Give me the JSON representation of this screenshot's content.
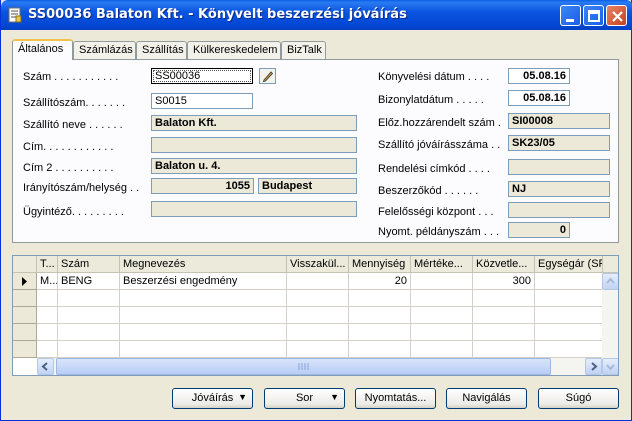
{
  "window": {
    "title": "SS00036 Balaton Kft. - Könyvelt beszerzési jóváírás"
  },
  "tabs": [
    {
      "label": "Általános",
      "active": true
    },
    {
      "label": "Számlázás"
    },
    {
      "label": "Szállítás"
    },
    {
      "label": "Külkereskedelem"
    },
    {
      "label": "BizTalk"
    }
  ],
  "general": {
    "left": [
      {
        "label": "Szám . . . . . . . . . . .",
        "value": "SS00036"
      },
      {
        "label": "Szállítószám. . . . . . .",
        "value": "S0015"
      },
      {
        "label": "Szállító neve . . . . . .",
        "value": "Balaton Kft."
      },
      {
        "label": "Cím. . . . . . . . . . . .",
        "value": ""
      },
      {
        "label": "Cím 2 . . . . . . . . . .",
        "value": "Balaton u. 4."
      },
      {
        "label": "Irányítószám/helység . .",
        "value": "1055",
        "value2": "Budapest"
      },
      {
        "label": "Ügyintéző. . . . . . . . .",
        "value": ""
      }
    ],
    "right": [
      {
        "label": "Könyvelési dátum . . . .",
        "value": "05.08.16"
      },
      {
        "label": "Bizonylatdátum . . . . .",
        "value": "05.08.16"
      },
      {
        "label": "Előz.hozzárendelt szám .",
        "value": "SI00008"
      },
      {
        "label": "Szállító jóváírásszáma . .",
        "value": "SK23/05"
      },
      {
        "label": "Rendelési címkód . . . .",
        "value": ""
      },
      {
        "label": "Beszerzőkód . . . . . .",
        "value": "NJ"
      },
      {
        "label": "Felelősségi központ . . .",
        "value": ""
      },
      {
        "label": "Nyomt. példányszám . . .",
        "value": "0"
      }
    ]
  },
  "lines": {
    "columns": [
      "T...",
      "Szám",
      "Megnevezés",
      "Visszakül...",
      "Mennyiség",
      "Mértéke...",
      "Közvetle...",
      "Egységár (SF"
    ],
    "rows": [
      {
        "type": "M...",
        "number": "BENG",
        "description": "Beszerzési engedmény",
        "return": "",
        "quantity": "20",
        "unit": "",
        "direct_cost": "300",
        "unit_price": ""
      }
    ]
  },
  "buttons": {
    "credit": "Jóváírás",
    "line": "Sor",
    "print": "Nyomtatás...",
    "navigate": "Navigálás",
    "help": "Súgó"
  },
  "colors": {
    "titlebar": "#0449d6",
    "window_bg": "#ece9d8",
    "active_tab_accent": "#f4c248"
  }
}
